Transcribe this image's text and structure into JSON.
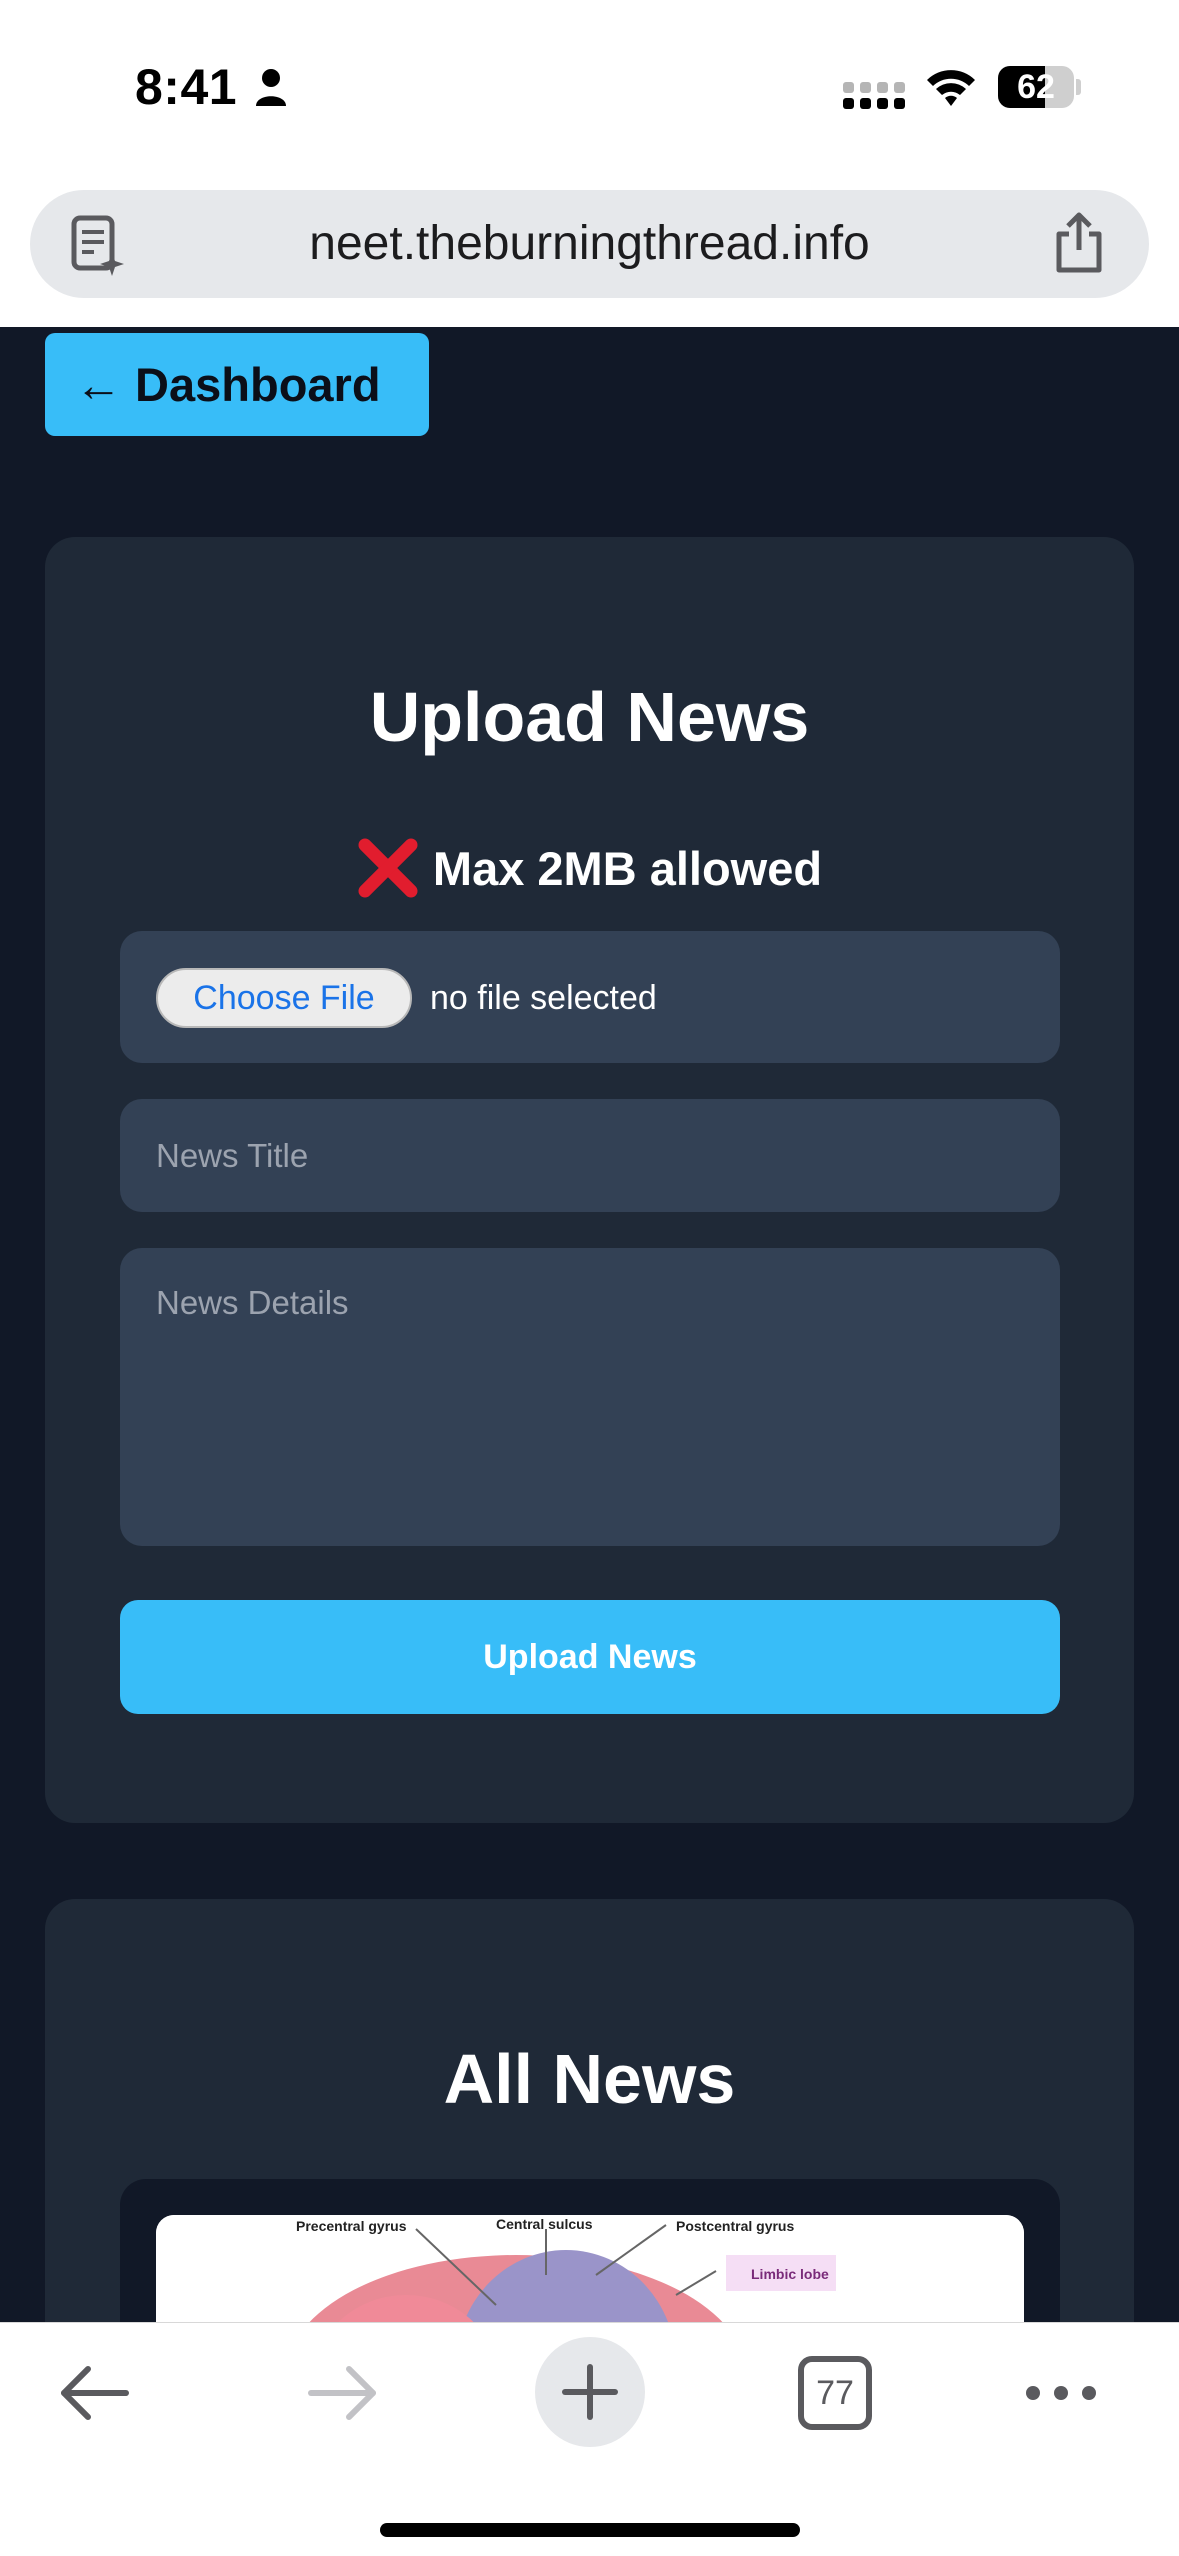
{
  "status_bar": {
    "time": "8:41",
    "battery_level": "62",
    "battery_fraction": 0.62
  },
  "browser": {
    "url": "neet.theburningthread.info",
    "tab_count": "77"
  },
  "page": {
    "dashboard_button": "← Dashboard",
    "upload_card": {
      "title": "Upload News",
      "limit_text": "Max 2MB allowed",
      "choose_file_label": "Choose File",
      "file_status": "no file selected",
      "title_placeholder": "News Title",
      "details_placeholder": "News Details",
      "submit_label": "Upload News"
    },
    "news_card": {
      "title": "All News",
      "image_labels": [
        "Precentral gyrus",
        "Central sulcus",
        "Postcentral gyrus",
        "Limbic lobe"
      ]
    }
  },
  "colors": {
    "accent": "#38bdf8",
    "page_bg": "#111827",
    "card_bg": "#1f2937",
    "field_bg": "#334155"
  },
  "icons": {
    "reader": "reader-mode-icon",
    "share": "share-icon",
    "error": "cross-mark-icon",
    "back": "back-arrow-icon",
    "forward": "forward-arrow-icon",
    "new_tab": "plus-icon",
    "tabs": "tabs-icon",
    "more": "more-dots-icon"
  }
}
